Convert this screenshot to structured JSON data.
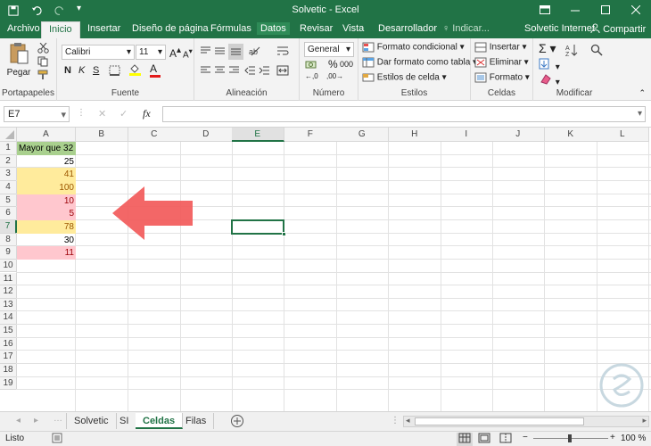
{
  "window": {
    "title": "Solvetic - Excel",
    "qat_icons": [
      "save-icon",
      "undo-icon",
      "redo-icon",
      "customize-icon"
    ],
    "controls": [
      "minimize-icon",
      "maximize-icon",
      "close-icon"
    ],
    "ribbon_display_icon": "ribbon-display-icon"
  },
  "tabs": [
    "Archivo",
    "Inicio",
    "Insertar",
    "Diseño de página",
    "Fórmulas",
    "Datos",
    "Revisar",
    "Vista",
    "Desarrollador"
  ],
  "active_tab": "Inicio",
  "tell_me": "♀ Indicar...",
  "account": "Solvetic Internet",
  "share": "Compartir",
  "ribbon": {
    "clipboard": {
      "paste": "Pegar",
      "label": "Portapapeles"
    },
    "font": {
      "name": "Calibri",
      "size": "11",
      "bold": "N",
      "italic": "K",
      "underline": "S",
      "label": "Fuente"
    },
    "alignment": {
      "label": "Alineación"
    },
    "number": {
      "format": "General",
      "percent": "%",
      "thousands": "000",
      "label": "Número"
    },
    "styles": {
      "cond_format": "Formato condicional",
      "table_format": "Dar formato como tabla",
      "cell_styles": "Estilos de celda",
      "label": "Estilos"
    },
    "cells": {
      "insert": "Insertar",
      "delete": "Eliminar",
      "format": "Formato",
      "label": "Celdas"
    },
    "editing": {
      "label": "Modificar"
    }
  },
  "formula_bar": {
    "name_box": "E7",
    "fx": "fx",
    "value": ""
  },
  "columns": [
    "A",
    "B",
    "C",
    "D",
    "E",
    "F",
    "G",
    "H",
    "I",
    "J",
    "K",
    "L"
  ],
  "rows": [
    "1",
    "2",
    "3",
    "4",
    "5",
    "6",
    "7",
    "8",
    "9",
    "10",
    "11",
    "12",
    "13",
    "14",
    "15",
    "16",
    "17",
    "18",
    "19"
  ],
  "cells": [
    {
      "row": 1,
      "value": "Mayor que 32",
      "fill": "#a9d08e",
      "color": "#000000",
      "align": "left"
    },
    {
      "row": 2,
      "value": "25",
      "fill": "",
      "color": "#000000",
      "align": "right"
    },
    {
      "row": 3,
      "value": "41",
      "fill": "#ffeb9c",
      "color": "#9c5700",
      "align": "right"
    },
    {
      "row": 4,
      "value": "100",
      "fill": "#ffeb9c",
      "color": "#9c5700",
      "align": "right"
    },
    {
      "row": 5,
      "value": "10",
      "fill": "#ffc7ce",
      "color": "#9c0006",
      "align": "right"
    },
    {
      "row": 6,
      "value": "5",
      "fill": "#ffc7ce",
      "color": "#9c0006",
      "align": "right"
    },
    {
      "row": 7,
      "value": "78",
      "fill": "#ffeb9c",
      "color": "#9c5700",
      "align": "right"
    },
    {
      "row": 8,
      "value": "30",
      "fill": "",
      "color": "#000000",
      "align": "right"
    },
    {
      "row": 9,
      "value": "11",
      "fill": "#ffc7ce",
      "color": "#9c0006",
      "align": "right"
    }
  ],
  "selected_cell": {
    "col": "E",
    "row": "7"
  },
  "sheets": [
    "Solvetic",
    "SI",
    "Celdas",
    "Filas"
  ],
  "active_sheet": "Celdas",
  "add_sheet_icon": "plus-icon",
  "status": {
    "ready": "Listo",
    "zoom": "100 %"
  },
  "colors": {
    "accent": "#217346",
    "arrow": "#f25a5a"
  },
  "watermark_logo": "solvetic-logo"
}
